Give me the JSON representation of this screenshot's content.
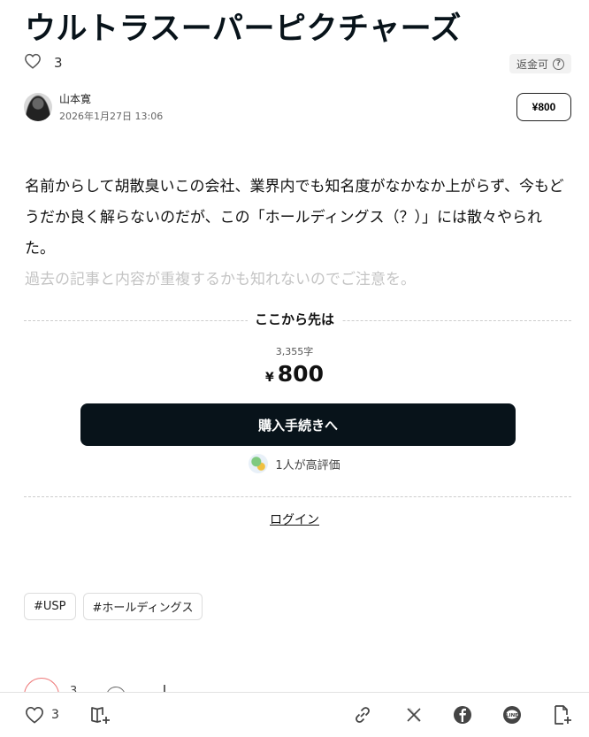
{
  "article": {
    "title": "ウルトラスーパーピクチャーズ",
    "like_count": "3",
    "refund_label": "返金可",
    "refund_help": "?",
    "author_name": "山本寛",
    "date": "2026年1月27日 13:06",
    "price_button": "¥800",
    "body": "名前からして胡散臭いこの会社、業界内でも知名度がなかなか上がらず、今もどうだか良く解らないのだが、この「ホールディングス（？）」には散々やられた。",
    "faded_text": "過去の記事と内容が重複するかも知れないのでご注意を。"
  },
  "paywall": {
    "label": "ここから先は",
    "char_count": "3,355字",
    "yen": "¥",
    "price": "800",
    "buy_button": "購入手続きへ",
    "rating_text": "1人が高評価",
    "login_link": "ログイン"
  },
  "tags": [
    "#USP",
    "#ホールディングス"
  ],
  "actions": {
    "partial_like_count": "3"
  },
  "bottom_bar": {
    "like_count": "3",
    "icons": [
      "heart-icon",
      "magazine-add-icon",
      "link-icon",
      "x-icon",
      "facebook-icon",
      "line-icon",
      "embed-icon"
    ]
  },
  "colors": {
    "text": "#08131a",
    "buy_button_bg": "#08131a",
    "faded": "#c4c4c4",
    "like_accent": "#e77777"
  }
}
